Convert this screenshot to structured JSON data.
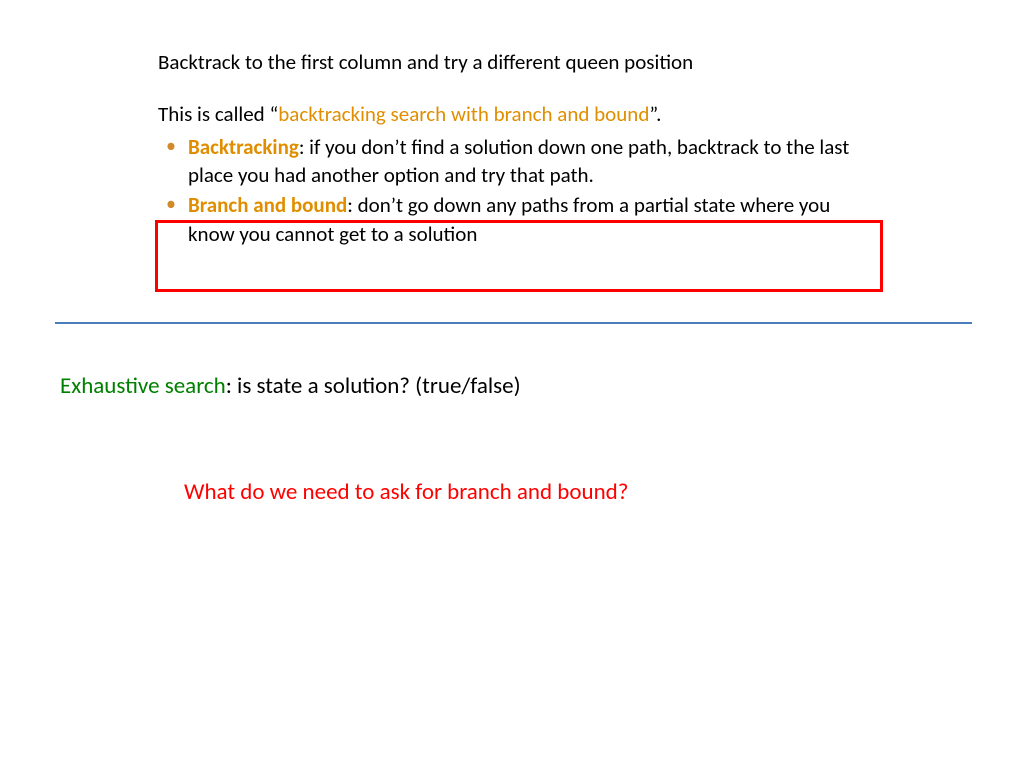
{
  "top": {
    "line1": "Backtrack to the first column and try a different queen position",
    "intro_pre": "This is called “",
    "intro_highlight": "backtracking search with branch and bound",
    "intro_post": "”.",
    "bullets": [
      {
        "term": "Backtracking",
        "rest": ": if you don’t find a solution down one path, backtrack to the last place you had another option and try that path."
      },
      {
        "term": "Branch and bound",
        "rest": ": don’t go down any paths from a partial state where you know you cannot get to a solution"
      }
    ]
  },
  "middle": {
    "exhaustive_term": "Exhaustive search",
    "exhaustive_rest": ": is state a solution? (true/false)"
  },
  "bottom": {
    "question": "What do we need to ask for branch and bound?"
  }
}
